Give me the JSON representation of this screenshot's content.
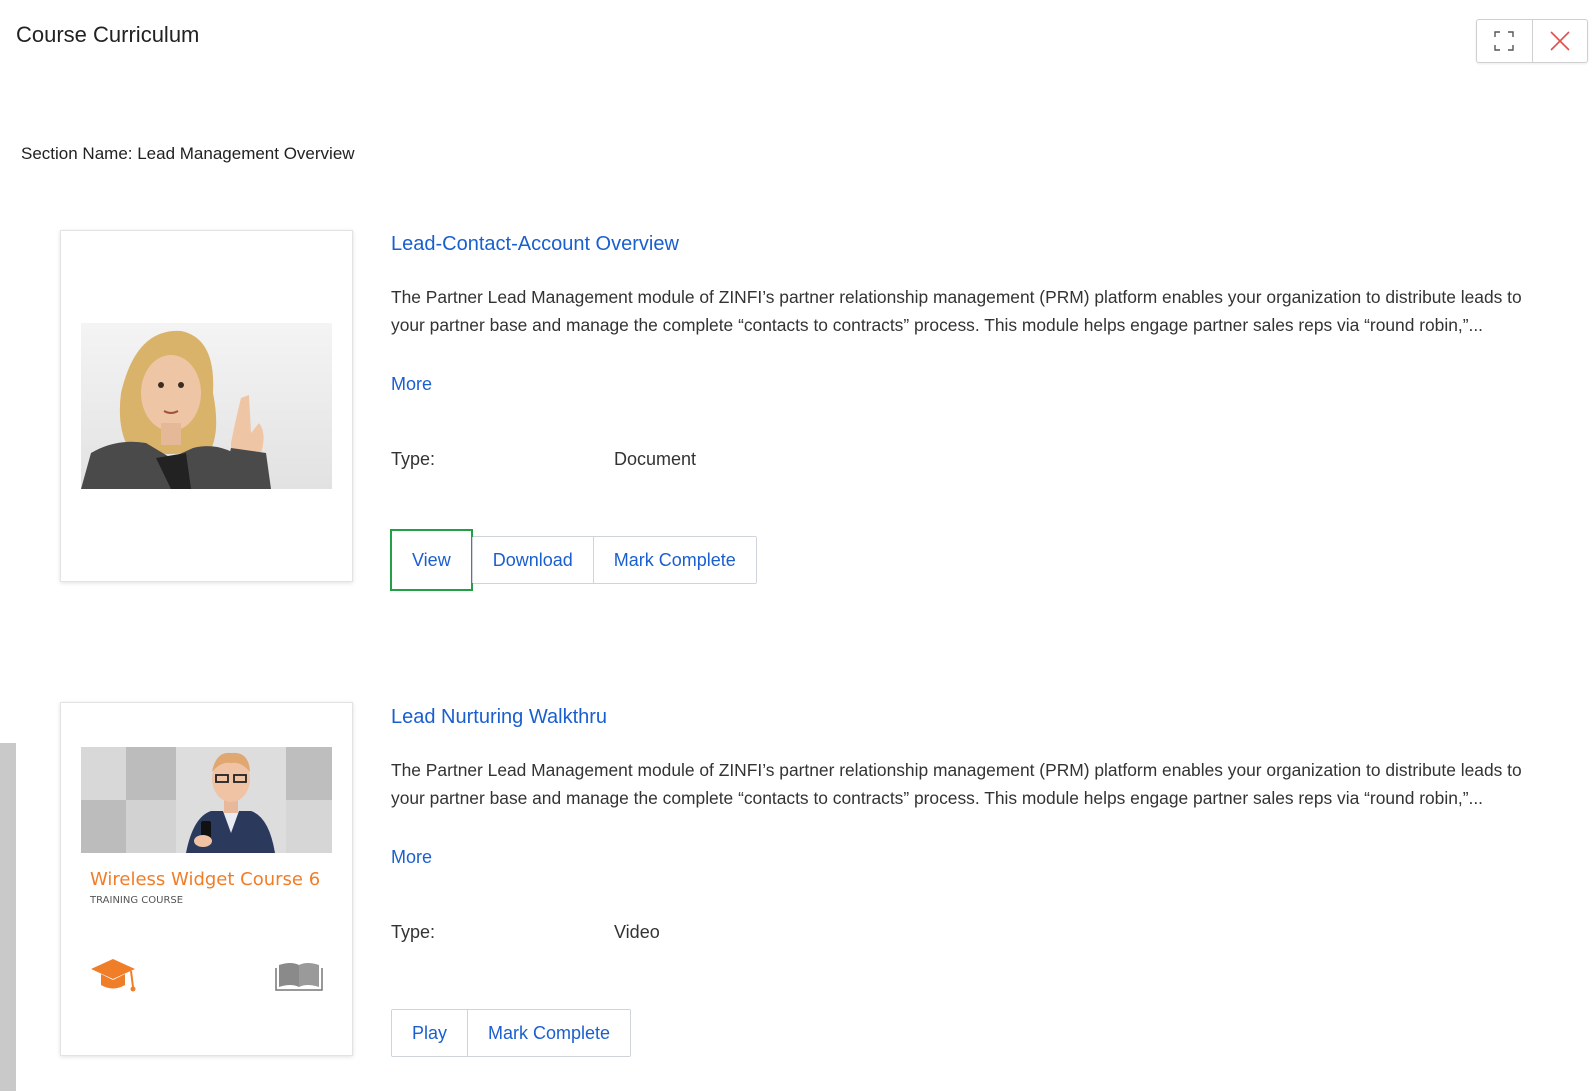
{
  "modal": {
    "title": "Course Curriculum"
  },
  "window_controls": {
    "expand_icon": "expand-icon",
    "close_icon": "close-icon",
    "close_color": "#e05050"
  },
  "section": {
    "label": "Section Name: Lead Management Overview"
  },
  "lessons": [
    {
      "title": "Lead-Contact-Account Overview",
      "description": "The Partner Lead Management module of ZINFI’s partner relationship management (PRM) platform enables your organization to distribute leads to your partner base and manage the complete “contacts to contracts” process. This module helps engage partner sales reps via “round robin,”...",
      "more": "More",
      "type_label": "Type:",
      "type_value": "Document",
      "buttons": [
        "View",
        "Download",
        "Mark Complete"
      ]
    },
    {
      "title": "Lead Nurturing Walkthru",
      "description": "The Partner Lead Management module of ZINFI’s partner relationship management (PRM) platform enables your organization to distribute leads to your partner base and manage the complete “contacts to contracts” process. This module helps engage partner sales reps via “round robin,”...",
      "more": "More",
      "type_label": "Type:",
      "type_value": "Video",
      "thumbnail": {
        "title": "Wireless Widget Course 6",
        "subtitle": "TRAINING COURSE",
        "accent": "#f07d28"
      },
      "buttons": [
        "Play",
        "Mark Complete"
      ]
    }
  ],
  "colors": {
    "link": "#1a5fcf",
    "focus": "#22a045"
  }
}
